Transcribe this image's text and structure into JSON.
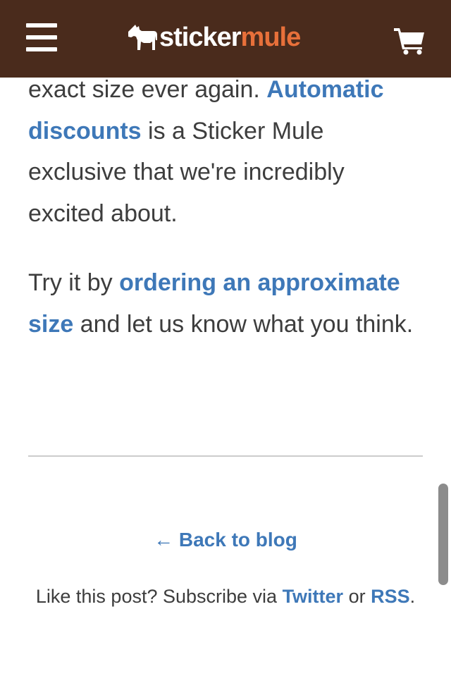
{
  "header": {
    "logo_word1": "sticker",
    "logo_word2": "mule",
    "menu_icon": "hamburger-menu-icon",
    "cart_icon": "shopping-cart-icon",
    "background_color": "#4a2b1c",
    "accent_color": "#e8703a"
  },
  "article": {
    "p1_text1": "exact size ever again. ",
    "p1_link": "Automatic discounts",
    "p1_text2": " is a Sticker Mule exclusive that we're incredibly excited about.",
    "p2_text1": "Try it by ",
    "p2_link": "ordering an approximate size",
    "p2_text2": " and let us know what you think.",
    "link_color": "#3e78b8"
  },
  "footer": {
    "back_arrow": "←",
    "back_label": "Back to blog",
    "subscribe_text": "Like this post? Subscribe via ",
    "twitter_label": "Twitter",
    "or_text": " or ",
    "rss_label": "RSS",
    "period": "."
  }
}
